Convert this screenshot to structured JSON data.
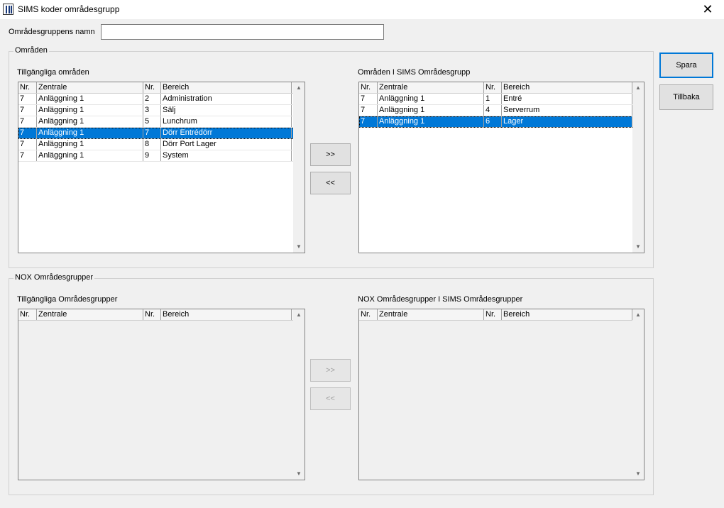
{
  "window": {
    "title": "SIMS koder områdesgrupp",
    "close_glyph": "✕"
  },
  "name_field": {
    "label": "Områdesgruppens namn",
    "value": ""
  },
  "areas_group": {
    "legend": "Områden",
    "available_label": "Tillgängliga områden",
    "assigned_label": "Områden I SIMS Områdesgrupp",
    "columns": [
      "Nr.",
      "Zentrale",
      "Nr.",
      "Bereich"
    ],
    "available_rows": [
      {
        "nr": "7",
        "zentrale": "Anläggning 1",
        "nr2": "2",
        "bereich": "Administration",
        "selected": false
      },
      {
        "nr": "7",
        "zentrale": "Anläggning 1",
        "nr2": "3",
        "bereich": "Sälj",
        "selected": false
      },
      {
        "nr": "7",
        "zentrale": "Anläggning 1",
        "nr2": "5",
        "bereich": "Lunchrum",
        "selected": false
      },
      {
        "nr": "7",
        "zentrale": "Anläggning 1",
        "nr2": "7",
        "bereich": "Dörr Entrédörr",
        "selected": true
      },
      {
        "nr": "7",
        "zentrale": "Anläggning 1",
        "nr2": "8",
        "bereich": "Dörr Port Lager",
        "selected": false
      },
      {
        "nr": "7",
        "zentrale": "Anläggning 1",
        "nr2": "9",
        "bereich": "System",
        "selected": false
      }
    ],
    "assigned_rows": [
      {
        "nr": "7",
        "zentrale": "Anläggning 1",
        "nr2": "1",
        "bereich": "Entré",
        "selected": false
      },
      {
        "nr": "7",
        "zentrale": "Anläggning 1",
        "nr2": "4",
        "bereich": "Serverrum",
        "selected": false
      },
      {
        "nr": "7",
        "zentrale": "Anläggning 1",
        "nr2": "6",
        "bereich": "Lager",
        "selected": true
      }
    ],
    "add_label": ">>",
    "remove_label": "<<"
  },
  "nox_group": {
    "legend": "NOX Områdesgrupper",
    "available_label": "Tillgängliga Områdesgrupper",
    "assigned_label": "NOX Områdesgrupper I SIMS Områdesgrupper",
    "columns": [
      "Nr.",
      "Zentrale",
      "Nr.",
      "Bereich"
    ],
    "available_rows": [],
    "assigned_rows": [],
    "add_label": ">>",
    "remove_label": "<<"
  },
  "actions": {
    "save_label": "Spara",
    "back_label": "Tillbaka"
  },
  "icons": {
    "app": "app-icon",
    "scroll_up": "scroll-up-arrow-icon",
    "scroll_down": "scroll-down-arrow-icon"
  },
  "colors": {
    "selection": "#0078d7",
    "window_bg": "#f0f0f0"
  }
}
